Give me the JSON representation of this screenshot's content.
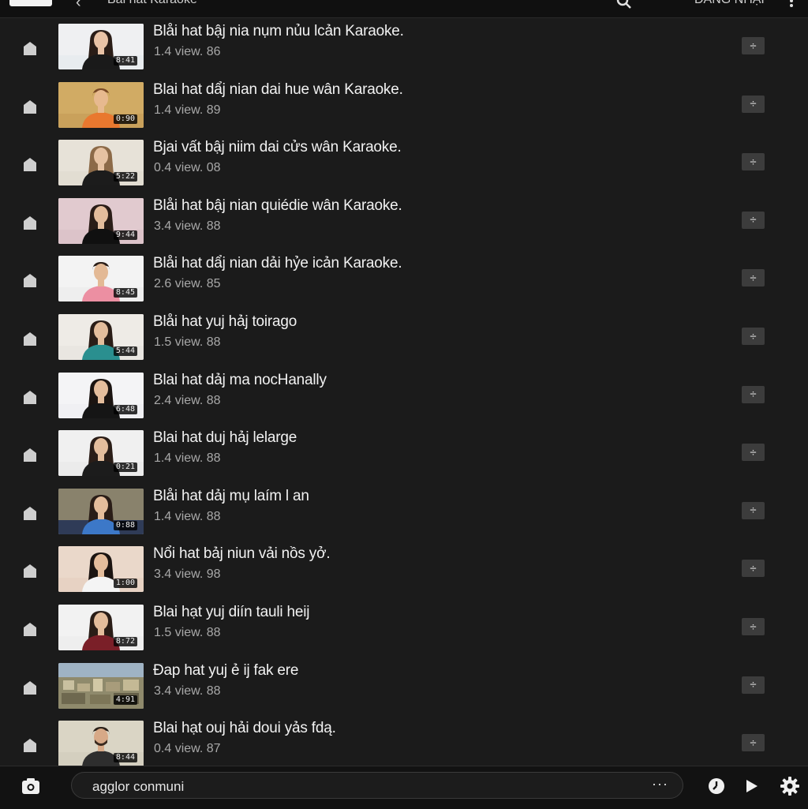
{
  "header": {
    "title": "Bài hát Karaoke",
    "right_text": "ĐĂNG NHẬP"
  },
  "videos": [
    {
      "title": "Blåi hat bậj nia nụm nủu lcản Karaoke.",
      "views": "1.4 view. 86",
      "duration": "8:41"
    },
    {
      "title": "Blai hat dẩj nian dai hue wân Karaoke.",
      "views": "1.4 view. 89",
      "duration": "0:90"
    },
    {
      "title": "Bjai vất bậj niim dai cửs wân Karaoke.",
      "views": "0.4 view. 08",
      "duration": "5:22"
    },
    {
      "title": "Blåi hat bậj nian quiédie wân Karaoke.",
      "views": "3.4 view. 88",
      "duration": "9:44"
    },
    {
      "title": "Blåi hat dẩj nian dải hỷe icản Karaoke.",
      "views": "2.6 view. 85",
      "duration": "8:45"
    },
    {
      "title": "Blåi hat yuj hảj toirago",
      "views": "1.5 view. 88",
      "duration": "5:44"
    },
    {
      "title": "Blai hat dảj ma nocHanally",
      "views": "2.4 view. 88",
      "duration": "6:48"
    },
    {
      "title": "Blai hat duj hảj lelarge",
      "views": "1.4 view. 88",
      "duration": "0:21"
    },
    {
      "title": "Blåi hat dảj mụ laím l an",
      "views": "1.4 view. 88",
      "duration": "0:88"
    },
    {
      "title": "Nổi hat bảj niun vải nồs yở.",
      "views": "3.4 view. 98",
      "duration": "1:00"
    },
    {
      "title": "Blai hạt yuj diín tauli heij",
      "views": "1.5 view. 88",
      "duration": "8:72"
    },
    {
      "title": "Đap hat yuj ẻ ij fak ere",
      "views": "3.4 view. 88",
      "duration": "4:91"
    },
    {
      "title": "Blai hạt ouj hải doui yảs fdą.",
      "views": "0.4 view. 87",
      "duration": "8:44"
    }
  ],
  "bottom": {
    "input_value": "agglor conmuni",
    "more_label": "···"
  },
  "colors": {
    "background": "#1b1b1b",
    "title_text": "#f2f2f2",
    "meta_text": "#a8a8a8",
    "button_bg": "#3c3c3c"
  },
  "icons": {
    "row_leading": "bookmark-icon",
    "row_trailing": "more-options-icon",
    "bottom_left": "camera-icon",
    "bottom_clock": "clock-icon",
    "bottom_play": "play-icon",
    "bottom_settings": "gear-icon"
  }
}
